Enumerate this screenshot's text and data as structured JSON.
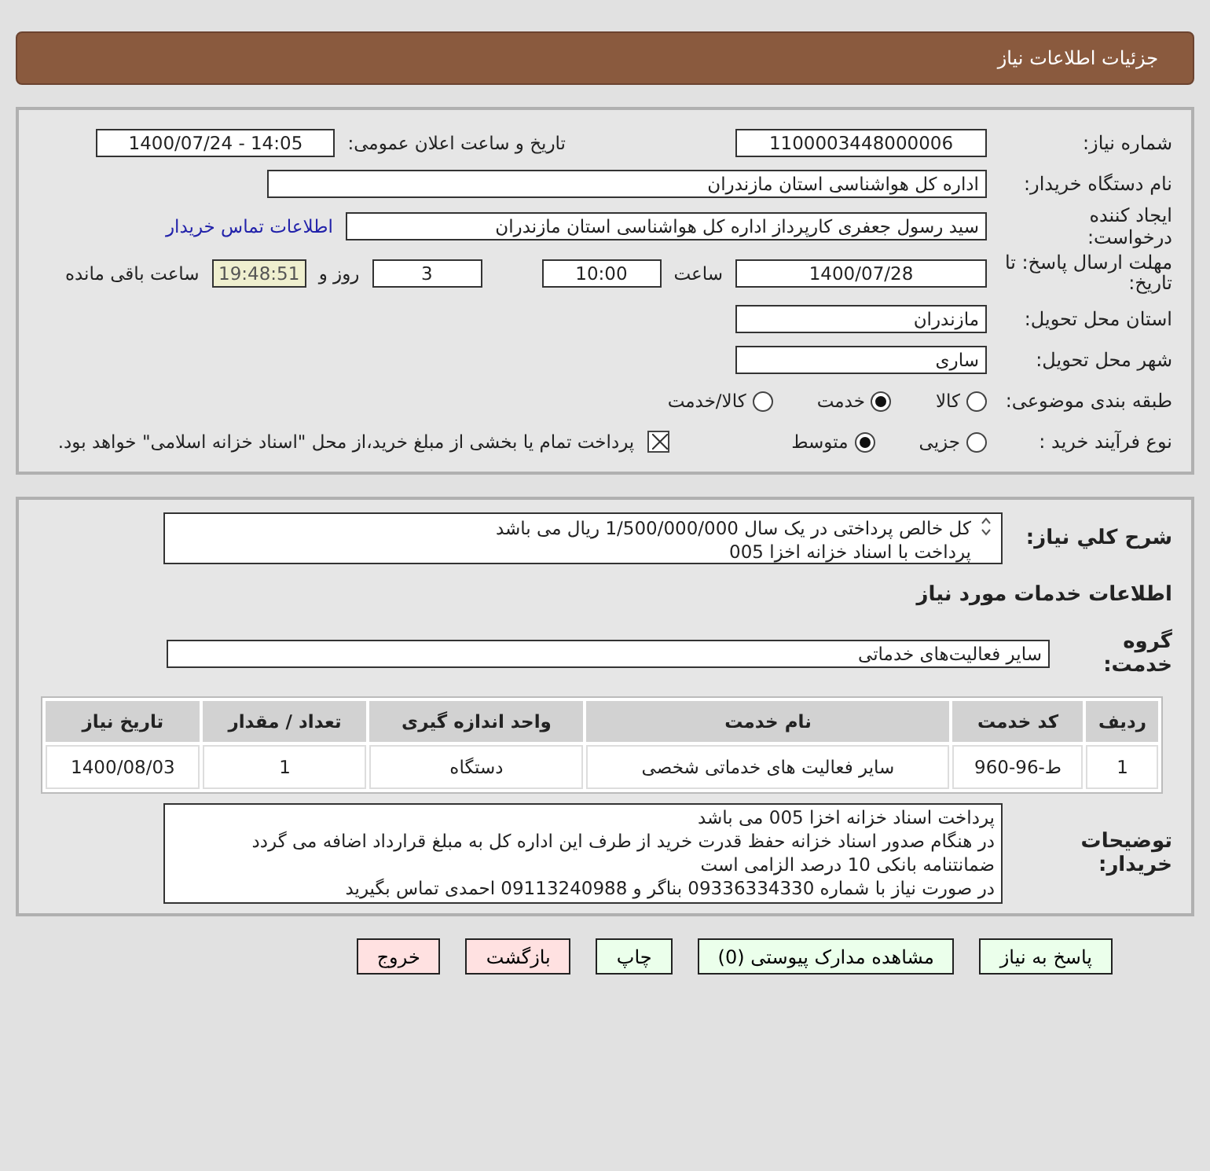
{
  "header": {
    "title": "جزئیات اطلاعات نیاز"
  },
  "details": {
    "need_number": {
      "label": "شماره نیاز:",
      "value": "1100003448000006"
    },
    "announce": {
      "label": "تاریخ و ساعت اعلان عمومی:",
      "value": "1400/07/24 - 14:05"
    },
    "buyer_org": {
      "label": "نام دستگاه خریدار:",
      "value": "اداره کل هواشناسی استان مازندران"
    },
    "requester": {
      "label": "ایجاد کننده درخواست:",
      "value": "سید رسول  جعفری کارپرداز اداره کل هواشناسی استان مازندران",
      "link": "اطلاعات تماس خریدار"
    },
    "deadline": {
      "label": "مهلت ارسال پاسخ: تا تاریخ:",
      "date": "1400/07/28",
      "time_label": "ساعت",
      "time": "10:00",
      "days": "3",
      "days_label": "روز و",
      "remaining": "19:48:51",
      "remaining_label": "ساعت باقی مانده"
    },
    "province": {
      "label": "استان محل تحویل:",
      "value": "مازندران"
    },
    "city": {
      "label": "شهر محل تحویل:",
      "value": "ساری"
    },
    "category": {
      "label": "طبقه بندی موضوعی:",
      "options": [
        {
          "label": "کالا",
          "selected": false
        },
        {
          "label": "خدمت",
          "selected": true
        },
        {
          "label": "کالا/خدمت",
          "selected": false
        }
      ]
    },
    "process": {
      "label": "نوع فرآیند خرید :",
      "options": [
        {
          "label": "جزیی",
          "selected": false
        },
        {
          "label": "متوسط",
          "selected": true
        }
      ],
      "payment": {
        "checked": true,
        "text": "پرداخت تمام یا بخشی از مبلغ خرید،از محل \"اسناد خزانه اسلامی\" خواهد بود."
      }
    }
  },
  "summary": {
    "label": "شرح کلي نياز:",
    "lines": [
      "کل خالص پرداختی در یک سال 1/500/000/000 ریال می باشد",
      "پرداخت با اسناد خزانه اخزا 005"
    ]
  },
  "services_title": "اطلاعات خدمات مورد نیاز",
  "service_group": {
    "label": "گروه خدمت:",
    "value": "سایر فعالیت‌های خدماتی"
  },
  "table": {
    "columns": [
      "ردیف",
      "کد خدمت",
      "نام خدمت",
      "واحد اندازه گیری",
      "تعداد / مقدار",
      "تاریخ نیاز"
    ],
    "rows": [
      [
        "1",
        "ط-96-960",
        "سایر فعالیت های خدماتی شخصی",
        "دستگاه",
        "1",
        "1400/08/03"
      ]
    ]
  },
  "buyer_notes": {
    "label": "توضیحات خریدار:",
    "lines": [
      "پرداخت اسناد خزانه اخزا 005 می باشد",
      "در هنگام صدور اسناد خزانه حفظ قدرت خرید از طرف این اداره کل به مبلغ قرارداد اضافه می گردد",
      "ضمانتنامه بانکی 10 درصد الزامی است",
      "در صورت نیاز با شماره 09336334330 بناگر و 09113240988 احمدی تماس بگیرید"
    ]
  },
  "buttons": [
    {
      "label": "پاسخ به نیاز",
      "kind": "primary"
    },
    {
      "label": "مشاهده مدارک پیوستی (0)",
      "kind": "primary"
    },
    {
      "label": "چاپ",
      "kind": "primary"
    },
    {
      "label": "بازگشت",
      "kind": "danger"
    },
    {
      "label": "خروج",
      "kind": "danger"
    }
  ]
}
